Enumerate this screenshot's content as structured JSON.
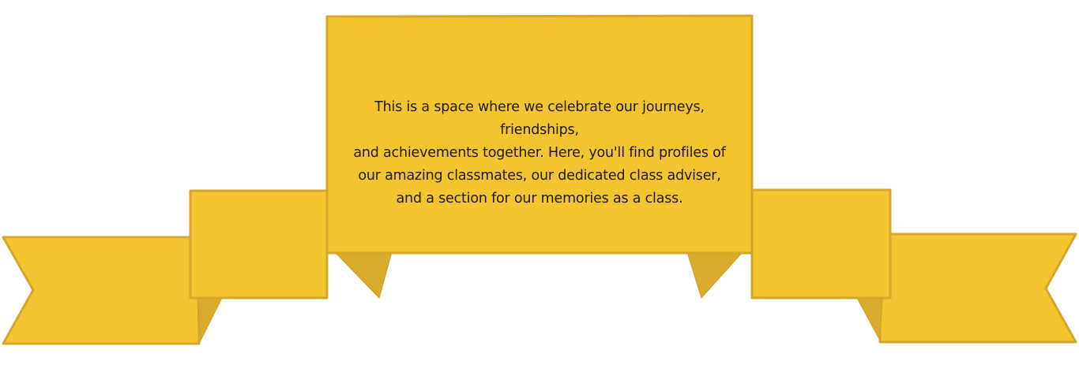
{
  "colors": {
    "ribbon_fill": "#f4c430",
    "ribbon_stroke": "#d4a62a",
    "ribbon_shadow": "#d9aa2b",
    "text": "#1f1a12",
    "background": "#ffffff"
  },
  "banner": {
    "lines": [
      "This is a space where we celebrate our journeys,",
      "friendships,",
      "and achievements together. Here, you'll find profiles of",
      "our amazing classmates, our dedicated class adviser,",
      "and a section for our memories as a class."
    ]
  }
}
